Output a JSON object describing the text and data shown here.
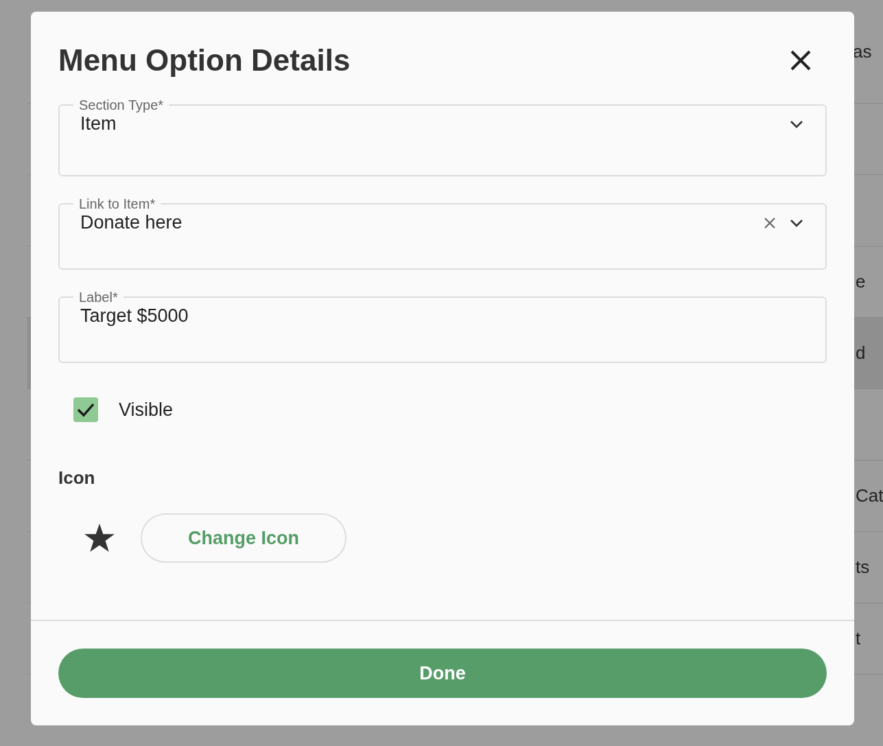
{
  "background": {
    "note_fragment": "as",
    "rows": [
      {
        "text": "",
        "highlighted": false
      },
      {
        "text": "",
        "highlighted": false
      },
      {
        "text": "e",
        "highlighted": false
      },
      {
        "text": "d",
        "highlighted": true
      },
      {
        "text": "",
        "highlighted": false
      },
      {
        "text": "Cat",
        "highlighted": false
      },
      {
        "text": "ts",
        "highlighted": false
      },
      {
        "text": "t",
        "highlighted": false
      },
      {
        "text": "",
        "highlighted": false
      }
    ]
  },
  "dialog": {
    "title": "Menu Option Details",
    "fields": [
      {
        "kind": "select",
        "label": "Section Type*",
        "value": "Item",
        "clearable": false
      },
      {
        "kind": "select",
        "label": "Link to Item*",
        "value": "Donate here",
        "clearable": true
      },
      {
        "kind": "text",
        "label": "Label*",
        "value": "Target $5000",
        "clearable": false
      }
    ],
    "visible": {
      "label": "Visible",
      "checked": true
    },
    "icon_section": {
      "heading": "Icon",
      "button": "Change Icon"
    },
    "done_button": "Done"
  }
}
